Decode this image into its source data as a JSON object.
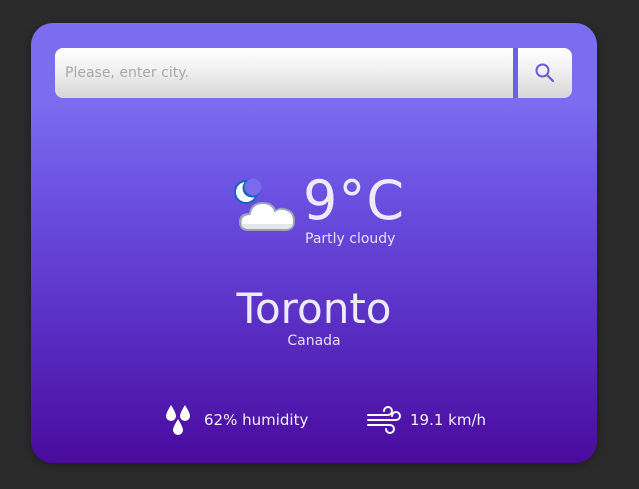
{
  "search": {
    "placeholder": "Please, enter city.",
    "button_icon": "search-icon"
  },
  "weather": {
    "icon": "partly-cloudy-night-icon",
    "temperature": "9°C",
    "condition": "Partly cloudy"
  },
  "location": {
    "city": "Toronto",
    "country": "Canada"
  },
  "stats": {
    "humidity_icon": "humidity-drops-icon",
    "humidity": "62% humidity",
    "wind_icon": "wind-icon",
    "wind": "19.1 km/h"
  },
  "colors": {
    "page_background": "#2b2b2b",
    "card_gradient_top": "#7c6cf0",
    "card_gradient_bottom": "#4a0a9e",
    "text": "#ecebf7"
  }
}
